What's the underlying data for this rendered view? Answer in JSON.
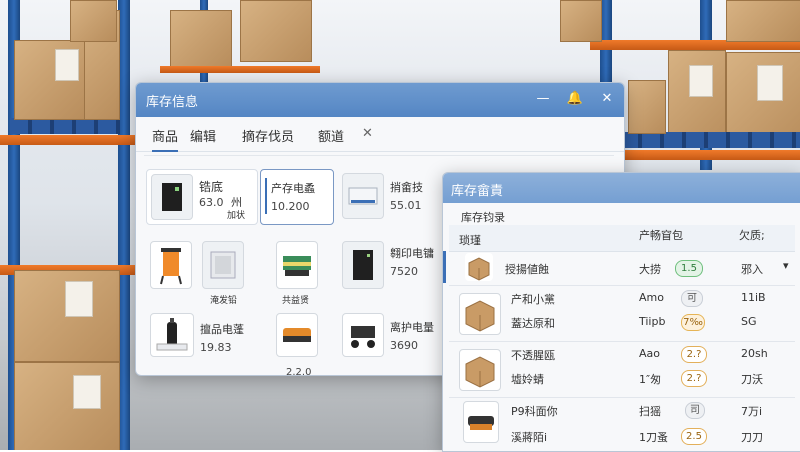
{
  "window_main": {
    "title": "库存信息",
    "controls": {
      "minimize": "—",
      "bell": "🔔",
      "close": "✕"
    },
    "tabs": [
      {
        "label": "商品"
      },
      {
        "label": "编辑"
      },
      {
        "label": "摘存伐员"
      },
      {
        "label": "额道"
      },
      {
        "label": "✕"
      }
    ],
    "products": [
      {
        "name": "锆底",
        "value": "63.0",
        "meta1": "州",
        "meta2": "加状"
      },
      {
        "name": "产存电蟊",
        "value": "10.200"
      },
      {
        "name": "捎畲技",
        "value": "55.01"
      },
      {
        "name": "",
        "value": "",
        "caption": "淹发铅"
      },
      {
        "name": "",
        "value": "",
        "caption": "共益贤"
      },
      {
        "name": "翱印电镛",
        "value": "7520"
      },
      {
        "name": "擅品电蓬",
        "value": "19.83"
      },
      {
        "name": "",
        "value": "2.2.0"
      },
      {
        "name": "离护电量",
        "value": "3690"
      }
    ]
  },
  "window_overlay": {
    "title": "库存畲責",
    "subtitle": "库存钧录",
    "table": {
      "headers": [
        "琐瑾",
        "产畅窅包",
        "欠质;"
      ],
      "rows": [
        {
          "name": "授揚値蝕",
          "c1": "大捞",
          "pill": "1.5",
          "pill_type": "green",
          "c3": "邪入",
          "chevron": "▾"
        },
        {
          "name": "产和小黨",
          "name2": "蓋达原和",
          "c1": "Amo",
          "c1b": "Tiipb",
          "pill": "可",
          "pill_type": "grey",
          "pill2": "7‰",
          "pill2_type": "orange",
          "c3": "11iB",
          "c3b": "SG"
        },
        {
          "name": "不透腥瓯",
          "name2": "墟姈蜻",
          "c1": "Aao",
          "c1b": "1″匆",
          "pill": "2.?",
          "pill_type": "outline",
          "pill2": "2.?",
          "pill2_type": "outline",
          "c3": "20sh",
          "c3b": "刀沃"
        },
        {
          "name": "P9科面你",
          "name2": "溪蔣陌i",
          "c1": "扫猺",
          "c1b": "1刀蚤",
          "pill": "司",
          "pill_type": "grey",
          "pill2": "2.5",
          "pill2_type": "outline",
          "c3": "7万i",
          "c3b": "刀刀"
        }
      ]
    }
  },
  "colors": {
    "title_bar": "#5486c4",
    "accent": "#3b6fb6",
    "rack_blue": "#2f6bb8",
    "beam_orange": "#f07a2a"
  }
}
